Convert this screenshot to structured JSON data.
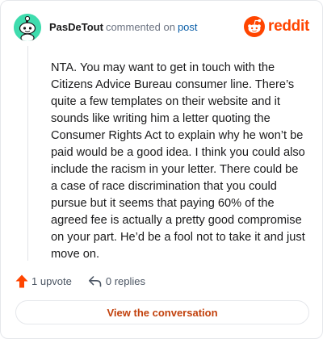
{
  "comment": {
    "username": "PasDeTout",
    "action_text": "commented on",
    "post_link_label": "post",
    "avatar_icon": "snoo-avatar-icon",
    "body": "NTA. You may want to get in touch with the Citizens Advice Bureau consumer line. There’s quite a few templates on their website and it sounds like writing him a letter quoting the Consumer Rights Act to explain why he won’t be paid would be a good idea. I think you could also include the racism in your letter. There could be a case of race discrimination that you could pursue but it seems that paying 60% of the agreed fee is actually a pretty good compromise on your part. He’d be a fool not to take it and just move on."
  },
  "brand": {
    "wordmark": "reddit",
    "icon": "reddit-logo-icon",
    "color": "#ff4500"
  },
  "actions": {
    "upvote_label": "1 upvote",
    "upvote_icon": "upvote-arrow-icon",
    "replies_label": "0 replies",
    "reply_icon": "reply-arrow-icon"
  },
  "view_button_label": "View the conversation",
  "colors": {
    "accent": "#ff4500",
    "link": "#0b5fa8",
    "button_text": "#c2410c",
    "avatar_bg": "#3fdcae"
  }
}
